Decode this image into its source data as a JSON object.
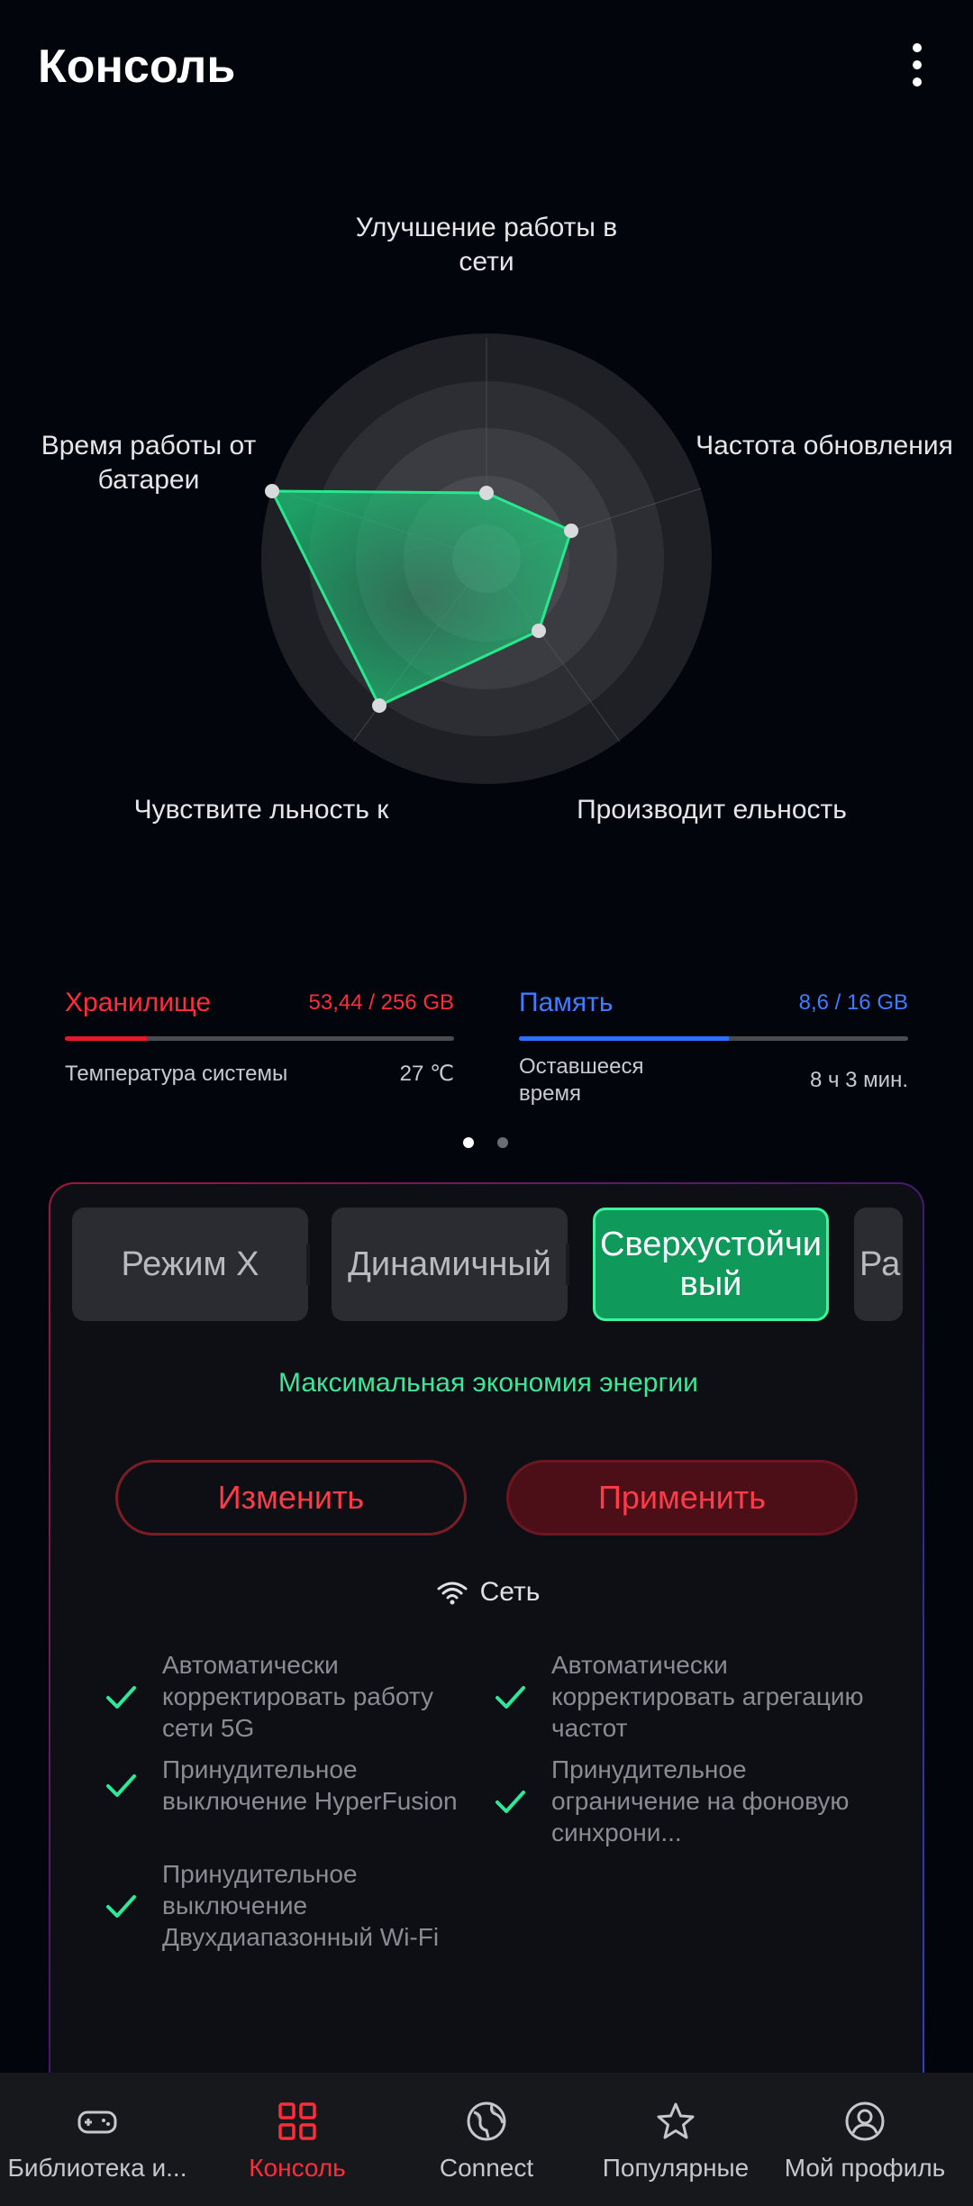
{
  "header": {
    "title": "Консоль"
  },
  "radar": {
    "labels": {
      "top": "Улучшение работы в сети",
      "right": "Частота обновления",
      "bottom_right": "Производит ельность",
      "bottom_left": "Чувствите льность к",
      "left": "Время работы от батареи"
    }
  },
  "stats": {
    "storage": {
      "title": "Хранилище",
      "value": "53,44 / 256 GB",
      "fill": 0.21,
      "color": "#e8182c"
    },
    "memory": {
      "title": "Память",
      "value": "8,6 / 16 GB",
      "fill": 0.54,
      "color": "#2f6fff"
    },
    "temperature": {
      "label": "Температура системы",
      "value": "27 ℃"
    },
    "remaining": {
      "label": "Оставшееся время",
      "value": "8 ч 3 мин."
    }
  },
  "pager": {
    "pages": 2,
    "current": 1
  },
  "modes": {
    "items": [
      "Режим X",
      "Динамичный",
      "Сверхустойчивый",
      "Ра"
    ],
    "active": "Сверхустойчивый",
    "description": "Максимальная экономия энергии"
  },
  "actions": {
    "change": "Изменить",
    "apply": "Применить"
  },
  "network": {
    "title": "Сеть",
    "features": [
      "Автоматически корректировать работу сети 5G",
      "Автоматически корректировать агрегацию частот",
      "Принудительное выключение HyperFusion",
      "Принудительное ограничение на фоновую синхрони...",
      "Принудительное выключение Двухдиапазонный Wi-Fi"
    ]
  },
  "nav": {
    "items": [
      {
        "label": "Библиотека и...",
        "icon": "gamepad-icon"
      },
      {
        "label": "Консоль",
        "icon": "console-grid-icon"
      },
      {
        "label": "Connect",
        "icon": "globe-icon"
      },
      {
        "label": "Популярные",
        "icon": "star-icon"
      },
      {
        "label": "Мой профиль",
        "icon": "profile-icon"
      }
    ],
    "active": "Консоль"
  }
}
